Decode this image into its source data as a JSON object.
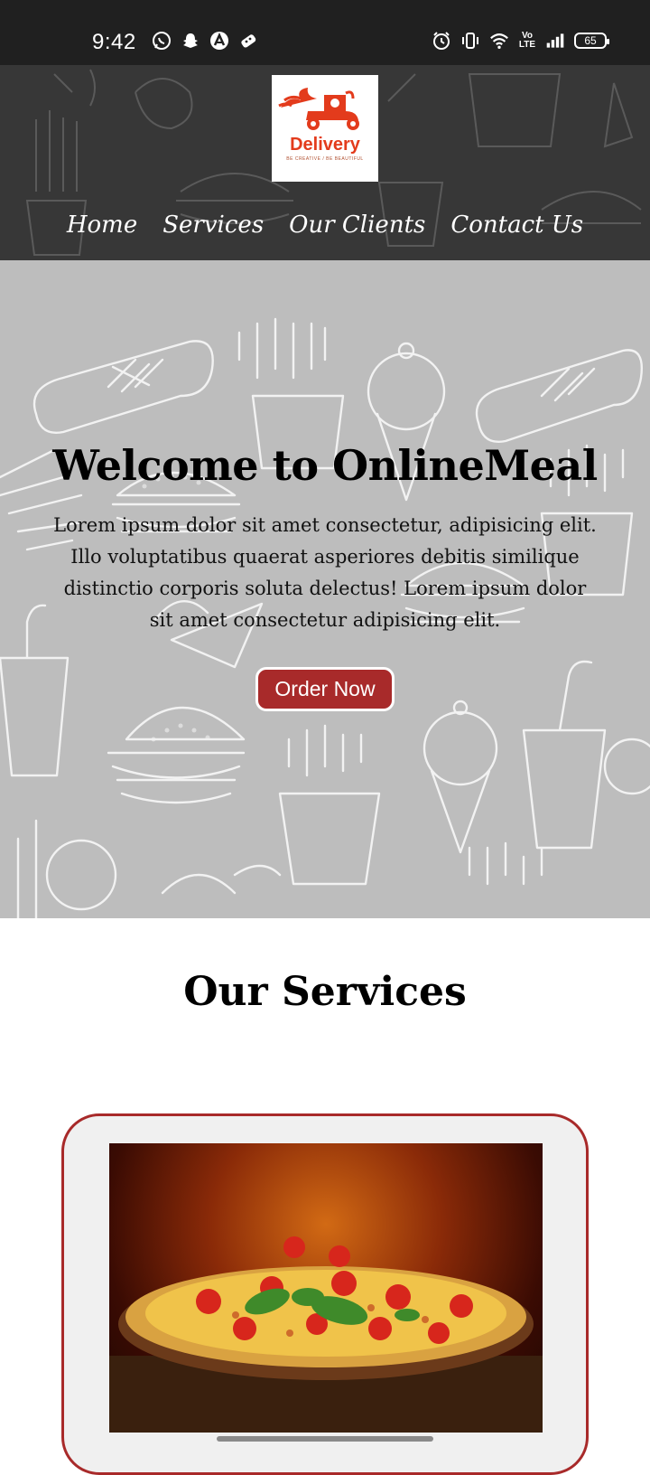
{
  "status_bar": {
    "time": "9:42",
    "battery": "65",
    "network_label": "Vo LTE",
    "icons": [
      "whatsapp-icon",
      "snapchat-icon",
      "arc-icon",
      "game-icon",
      "alarm-icon",
      "vibrate-icon",
      "wifi-icon",
      "volte-icon",
      "signal-icon",
      "battery-icon"
    ]
  },
  "header": {
    "logo_text": "Delivery",
    "logo_tagline": "BE CREATIVE / BE BEAUTIFUL",
    "nav": [
      {
        "label": "Home"
      },
      {
        "label": "Services"
      },
      {
        "label": "Our Clients"
      },
      {
        "label": "Contact Us"
      }
    ]
  },
  "hero": {
    "title": "Welcome to OnlineMeal",
    "body": "Lorem ipsum dolor sit amet consectetur, adipisicing elit. Illo voluptatibus quaerat asperiores debitis similique distinctio corporis soluta delectus! Lorem ipsum dolor sit amet consectetur adipisicing elit.",
    "cta": "Order Now"
  },
  "services": {
    "title": "Our Services"
  },
  "colors": {
    "header_bg": "#373737",
    "hero_bg": "#bdbdbd",
    "accent": "#a82a2a",
    "logo": "#e33b1c"
  }
}
